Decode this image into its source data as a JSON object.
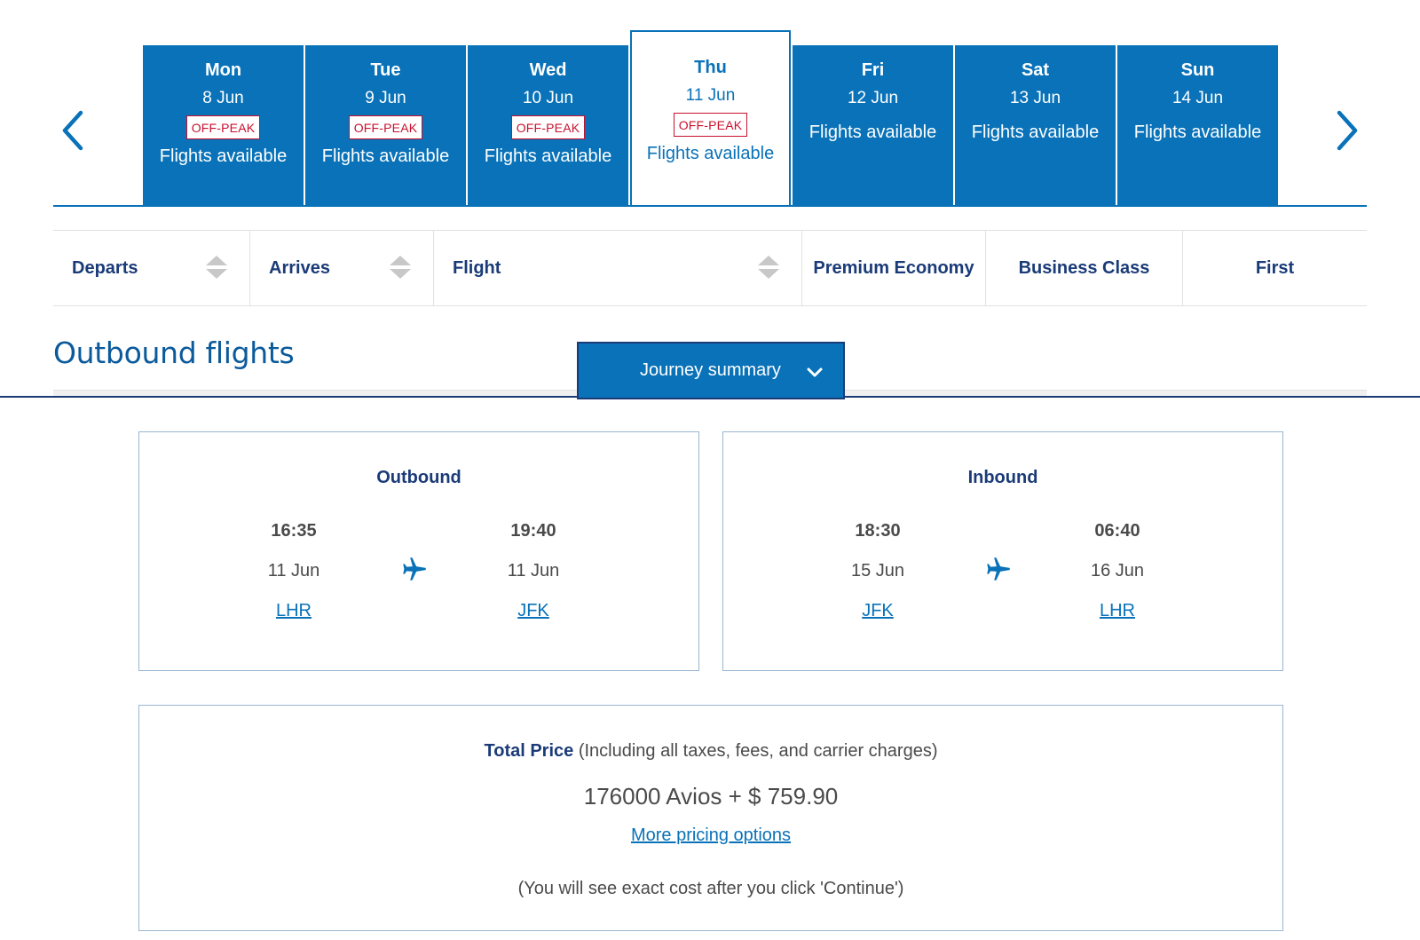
{
  "carousel": {
    "days": [
      {
        "name": "Mon",
        "date": "8 Jun",
        "badge": "OFF-PEAK",
        "status": "Flights available",
        "selected": false
      },
      {
        "name": "Tue",
        "date": "9 Jun",
        "badge": "OFF-PEAK",
        "status": "Flights available",
        "selected": false
      },
      {
        "name": "Wed",
        "date": "10 Jun",
        "badge": "OFF-PEAK",
        "status": "Flights available",
        "selected": false
      },
      {
        "name": "Thu",
        "date": "11 Jun",
        "badge": "OFF-PEAK",
        "status": "Flights available",
        "selected": true
      },
      {
        "name": "Fri",
        "date": "12 Jun",
        "badge": "",
        "status": "Flights available",
        "selected": false
      },
      {
        "name": "Sat",
        "date": "13 Jun",
        "badge": "",
        "status": "Flights available",
        "selected": false
      },
      {
        "name": "Sun",
        "date": "14 Jun",
        "badge": "",
        "status": "Flights available",
        "selected": false
      }
    ],
    "prev_icon": "chevron-left-icon",
    "next_icon": "chevron-right-icon"
  },
  "columns": {
    "departs": "Departs",
    "arrives": "Arrives",
    "flight": "Flight",
    "premium": "Premium Economy",
    "business": "Business Class",
    "first": "First"
  },
  "outbound_title": "Outbound flights",
  "journey_summary": {
    "label": "Journey summary",
    "icon": "chevron-down-icon"
  },
  "summary": {
    "outbound": {
      "title": "Outbound",
      "depart_time": "16:35",
      "depart_date": "11 Jun",
      "depart_code": "LHR",
      "arrive_time": "19:40",
      "arrive_date": "11 Jun",
      "arrive_code": "JFK"
    },
    "inbound": {
      "title": "Inbound",
      "depart_time": "18:30",
      "depart_date": "15 Jun",
      "depart_code": "JFK",
      "arrive_time": "06:40",
      "arrive_date": "16 Jun",
      "arrive_code": "LHR"
    }
  },
  "price": {
    "label": "Total Price",
    "qualifier": " (Including all taxes, fees, and carrier charges)",
    "amount": "176000 Avios + $ 759.90",
    "more_options": "More pricing options",
    "note": "(You will see exact cost after you click 'Continue')"
  },
  "colors": {
    "brand_blue": "#0972b8",
    "navy": "#1a3b78",
    "offpeak_red": "#c8102e"
  }
}
